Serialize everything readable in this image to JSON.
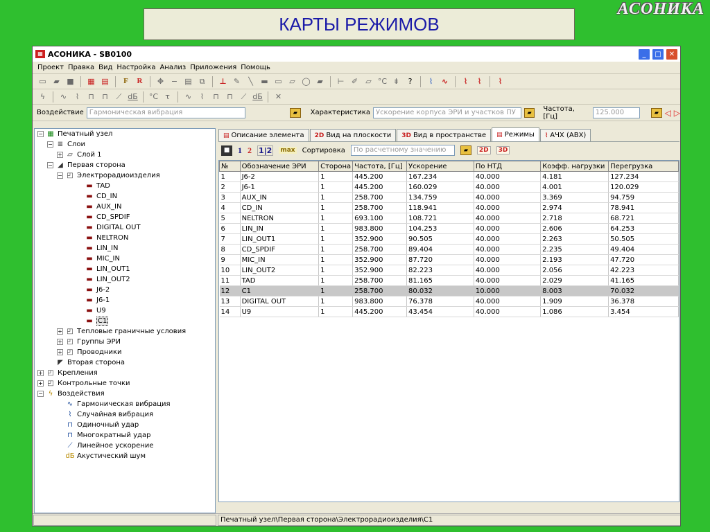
{
  "slide": {
    "title": "КАРТЫ РЕЖИМОВ",
    "logo": "АСОНИКА"
  },
  "window": {
    "title": "АСОНИКА - SB0100",
    "icon": "app-logo-icon",
    "controls": {
      "minimize": "_",
      "maximize": "□",
      "close": "✕"
    }
  },
  "menu": [
    "Проект",
    "Правка",
    "Вид",
    "Настройка",
    "Анализ",
    "Приложения",
    "Помощь"
  ],
  "toolbar1": {
    "icons": [
      "new-icon",
      "open-icon",
      "save-icon",
      "grid-icon",
      "grid2-icon",
      "f-icon",
      "r-icon",
      "move-icon",
      "minus-icon",
      "doc-icon",
      "copy-icon",
      "line-icon",
      "pen-icon",
      "diagonal-icon",
      "rect-icon",
      "flat-rect-icon",
      "para-icon",
      "circle-icon",
      "chip-icon",
      "wire-icon",
      "brush-icon",
      "temp-icon",
      "pin-icon",
      "help-icon",
      "graph-icon",
      "wave-icon",
      "graph2-icon",
      "graph3-icon",
      "graph4-icon"
    ],
    "labels": {
      "f": "F",
      "r": "R",
      "celsius": "°C"
    }
  },
  "toolbar2": {
    "labels": {
      "db": "dБ",
      "celsius": "°C",
      "tau": "τ"
    }
  },
  "params": {
    "impact_label": "Воздействие",
    "impact_value": "Гармоническая вибрация",
    "characteristic_label": "Характеристика",
    "characteristic_value": "Ускорение корпуса ЭРИ и участков ПУ",
    "frequency_label": "Частота, [Гц]",
    "frequency_value": "125.000"
  },
  "tree": [
    {
      "label": "Печатный узел",
      "depth": 0,
      "exp": "−",
      "icon": "pcb-icon",
      "glyph": "▦",
      "cls": "green"
    },
    {
      "label": "Слои",
      "depth": 1,
      "exp": "−",
      "icon": "layers-icon",
      "glyph": "≣",
      "cls": "dark"
    },
    {
      "label": "Слой 1",
      "depth": 2,
      "exp": "+",
      "icon": "layer-icon",
      "glyph": "▱",
      "cls": "dark"
    },
    {
      "label": "Первая сторона",
      "depth": 1,
      "exp": "−",
      "icon": "side-icon",
      "glyph": "◢",
      "cls": "dark"
    },
    {
      "label": "Электрорадиоизделия",
      "depth": 2,
      "exp": "−",
      "icon": "components-icon",
      "glyph": "◰",
      "cls": "dark"
    },
    {
      "label": "TAD",
      "depth": 4,
      "exp": "",
      "icon": "chip-icon",
      "glyph": "▬",
      "cls": "chip"
    },
    {
      "label": "CD_IN",
      "depth": 4,
      "exp": "",
      "icon": "chip-icon",
      "glyph": "▬",
      "cls": "chip"
    },
    {
      "label": "AUX_IN",
      "depth": 4,
      "exp": "",
      "icon": "chip-icon",
      "glyph": "▬",
      "cls": "chip"
    },
    {
      "label": "CD_SPDIF",
      "depth": 4,
      "exp": "",
      "icon": "chip-icon",
      "glyph": "▬",
      "cls": "chip"
    },
    {
      "label": "DIGITAL OUT",
      "depth": 4,
      "exp": "",
      "icon": "chip-icon",
      "glyph": "▬",
      "cls": "chip"
    },
    {
      "label": "NELTRON",
      "depth": 4,
      "exp": "",
      "icon": "chip-icon",
      "glyph": "▬",
      "cls": "chip"
    },
    {
      "label": "LIN_IN",
      "depth": 4,
      "exp": "",
      "icon": "chip-icon",
      "glyph": "▬",
      "cls": "chip"
    },
    {
      "label": "MIC_IN",
      "depth": 4,
      "exp": "",
      "icon": "chip-icon",
      "glyph": "▬",
      "cls": "chip"
    },
    {
      "label": "LIN_OUT1",
      "depth": 4,
      "exp": "",
      "icon": "chip-icon",
      "glyph": "▬",
      "cls": "chip"
    },
    {
      "label": "LIN_OUT2",
      "depth": 4,
      "exp": "",
      "icon": "chip-icon",
      "glyph": "▬",
      "cls": "chip"
    },
    {
      "label": "J6-2",
      "depth": 4,
      "exp": "",
      "icon": "chip-icon",
      "glyph": "▬",
      "cls": "chip"
    },
    {
      "label": "J6-1",
      "depth": 4,
      "exp": "",
      "icon": "chip-icon",
      "glyph": "▬",
      "cls": "chip"
    },
    {
      "label": "U9",
      "depth": 4,
      "exp": "",
      "icon": "chip-icon",
      "glyph": "▬",
      "cls": "chip"
    },
    {
      "label": "C1",
      "depth": 4,
      "exp": "",
      "icon": "chip-icon",
      "glyph": "▬",
      "cls": "chip",
      "selected": true
    },
    {
      "label": "Тепловые граничные условия",
      "depth": 2,
      "exp": "+",
      "icon": "folder-icon",
      "glyph": "◰",
      "cls": "dark"
    },
    {
      "label": "Группы ЭРИ",
      "depth": 2,
      "exp": "+",
      "icon": "folder-icon",
      "glyph": "◰",
      "cls": "dark"
    },
    {
      "label": "Проводники",
      "depth": 2,
      "exp": "+",
      "icon": "folder-icon",
      "glyph": "◰",
      "cls": "dark"
    },
    {
      "label": "Вторая сторона",
      "depth": 1,
      "exp": "",
      "icon": "side2-icon",
      "glyph": "◤",
      "cls": "dark"
    },
    {
      "label": "Крепления",
      "depth": 0,
      "exp": "+",
      "icon": "folder-icon",
      "glyph": "◰",
      "cls": "dark"
    },
    {
      "label": "Контрольные точки",
      "depth": 0,
      "exp": "+",
      "icon": "folder-icon",
      "glyph": "◰",
      "cls": "dark"
    },
    {
      "label": "Воздействия",
      "depth": 0,
      "exp": "−",
      "icon": "impacts-icon",
      "glyph": "ϟ",
      "cls": "vib"
    },
    {
      "label": "Гармоническая вибрация",
      "depth": 2,
      "exp": "",
      "icon": "harmonic-icon",
      "glyph": "∿",
      "cls": "wave"
    },
    {
      "label": "Случайная вибрация",
      "depth": 2,
      "exp": "",
      "icon": "random-icon",
      "glyph": "⌇",
      "cls": "wave"
    },
    {
      "label": "Одиночный удар",
      "depth": 2,
      "exp": "",
      "icon": "shock-icon",
      "glyph": "⊓",
      "cls": "wave"
    },
    {
      "label": "Многократный удар",
      "depth": 2,
      "exp": "",
      "icon": "multi-shock-icon",
      "glyph": "⊓",
      "cls": "wave"
    },
    {
      "label": "Линейное ускорение",
      "depth": 2,
      "exp": "",
      "icon": "linear-icon",
      "glyph": "⟋",
      "cls": "wave"
    },
    {
      "label": "Акустический шум",
      "depth": 2,
      "exp": "",
      "icon": "noise-icon",
      "glyph": "dБ",
      "cls": "vib"
    }
  ],
  "tabs": [
    {
      "label": "Описание элемента",
      "icon": "doc-icon",
      "glyph": "▤",
      "active": false
    },
    {
      "label": "Вид на плоскости",
      "icon": "2d-icon",
      "glyph": "2D",
      "active": false
    },
    {
      "label": "Вид в пространстве",
      "icon": "3d-icon",
      "glyph": "3D",
      "active": false
    },
    {
      "label": "Режимы",
      "icon": "modes-icon",
      "glyph": "▤",
      "active": true
    },
    {
      "label": "АЧХ (АВХ)",
      "icon": "afc-icon",
      "glyph": "⌇",
      "active": false
    }
  ],
  "subtool": {
    "b1": "1",
    "b2": "2",
    "b3": "1|2",
    "bmax": "max",
    "sort_label": "Сортировка",
    "sort_value": "По расчетному значению",
    "b2d": "2D",
    "b3d": "3D"
  },
  "table": {
    "headers": [
      "№",
      "Обозначение ЭРИ",
      "Сторона",
      "Частота, [Гц]",
      "Ускорение",
      "По НТД",
      "Коэфф. нагрузки",
      "Перегрузка"
    ],
    "rows": [
      [
        "1",
        "J6-2",
        "1",
        "445.200",
        "167.234",
        "40.000",
        "4.181",
        "127.234"
      ],
      [
        "2",
        "J6-1",
        "1",
        "445.200",
        "160.029",
        "40.000",
        "4.001",
        "120.029"
      ],
      [
        "3",
        "AUX_IN",
        "1",
        "258.700",
        "134.759",
        "40.000",
        "3.369",
        "94.759"
      ],
      [
        "4",
        "CD_IN",
        "1",
        "258.700",
        "118.941",
        "40.000",
        "2.974",
        "78.941"
      ],
      [
        "5",
        "NELTRON",
        "1",
        "693.100",
        "108.721",
        "40.000",
        "2.718",
        "68.721"
      ],
      [
        "6",
        "LIN_IN",
        "1",
        "983.800",
        "104.253",
        "40.000",
        "2.606",
        "64.253"
      ],
      [
        "7",
        "LIN_OUT1",
        "1",
        "352.900",
        "90.505",
        "40.000",
        "2.263",
        "50.505"
      ],
      [
        "8",
        "CD_SPDIF",
        "1",
        "258.700",
        "89.404",
        "40.000",
        "2.235",
        "49.404"
      ],
      [
        "9",
        "MIC_IN",
        "1",
        "352.900",
        "87.720",
        "40.000",
        "2.193",
        "47.720"
      ],
      [
        "10",
        "LIN_OUT2",
        "1",
        "352.900",
        "82.223",
        "40.000",
        "2.056",
        "42.223"
      ],
      [
        "11",
        "TAD",
        "1",
        "258.700",
        "81.165",
        "40.000",
        "2.029",
        "41.165"
      ],
      [
        "12",
        "C1",
        "1",
        "258.700",
        "80.032",
        "10.000",
        "8.003",
        "70.032"
      ],
      [
        "13",
        "DIGITAL OUT",
        "1",
        "983.800",
        "76.378",
        "40.000",
        "1.909",
        "36.378"
      ],
      [
        "14",
        "U9",
        "1",
        "445.200",
        "43.454",
        "40.000",
        "1.086",
        "3.454"
      ]
    ],
    "selected_row": 11
  },
  "status": {
    "left": "",
    "path": "Печатный узел\\Первая сторона\\Электрорадиоизделия\\C1"
  }
}
